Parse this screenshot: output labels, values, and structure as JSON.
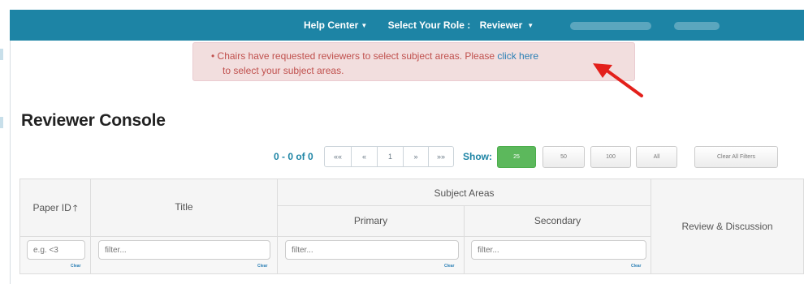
{
  "nav": {
    "help_center": "Help Center",
    "select_role_label": "Select Your Role :",
    "role": "Reviewer"
  },
  "alert": {
    "bullet": "•",
    "text_before_link": "Chairs have requested reviewers to select subject areas. Please ",
    "link": "click here",
    "text_after_link": "to select your subject areas."
  },
  "page_title": "Reviewer Console",
  "pager": {
    "range": "0 - 0 of 0",
    "buttons": [
      "««",
      "«",
      "1",
      "»",
      "»»"
    ],
    "show_label": "Show:",
    "page_sizes": [
      "25",
      "50",
      "100",
      "All"
    ],
    "active_page_size": "25",
    "clear_all_filters": "Clear All Filters"
  },
  "table": {
    "headers": {
      "paper_id": "Paper ID",
      "title": "Title",
      "subject_areas": "Subject Areas",
      "primary": "Primary",
      "secondary": "Secondary",
      "review_discussion": "Review & Discussion"
    },
    "filters": {
      "paper_id_placeholder": "e.g. <3",
      "title_placeholder": "filter...",
      "primary_placeholder": "filter...",
      "secondary_placeholder": "filter...",
      "clear_label": "Clear"
    }
  },
  "icons": {
    "sort": "arrow-up-icon",
    "caret": "caret-down-icon",
    "annotation": "red-arrow-icon"
  },
  "colors": {
    "navbar": "#1d84a5",
    "alert_bg": "#f2dede",
    "alert_text": "#c0504d",
    "link": "#2a7fb5",
    "active_button": "#5cb85c",
    "annotation_arrow": "#e3201b"
  }
}
